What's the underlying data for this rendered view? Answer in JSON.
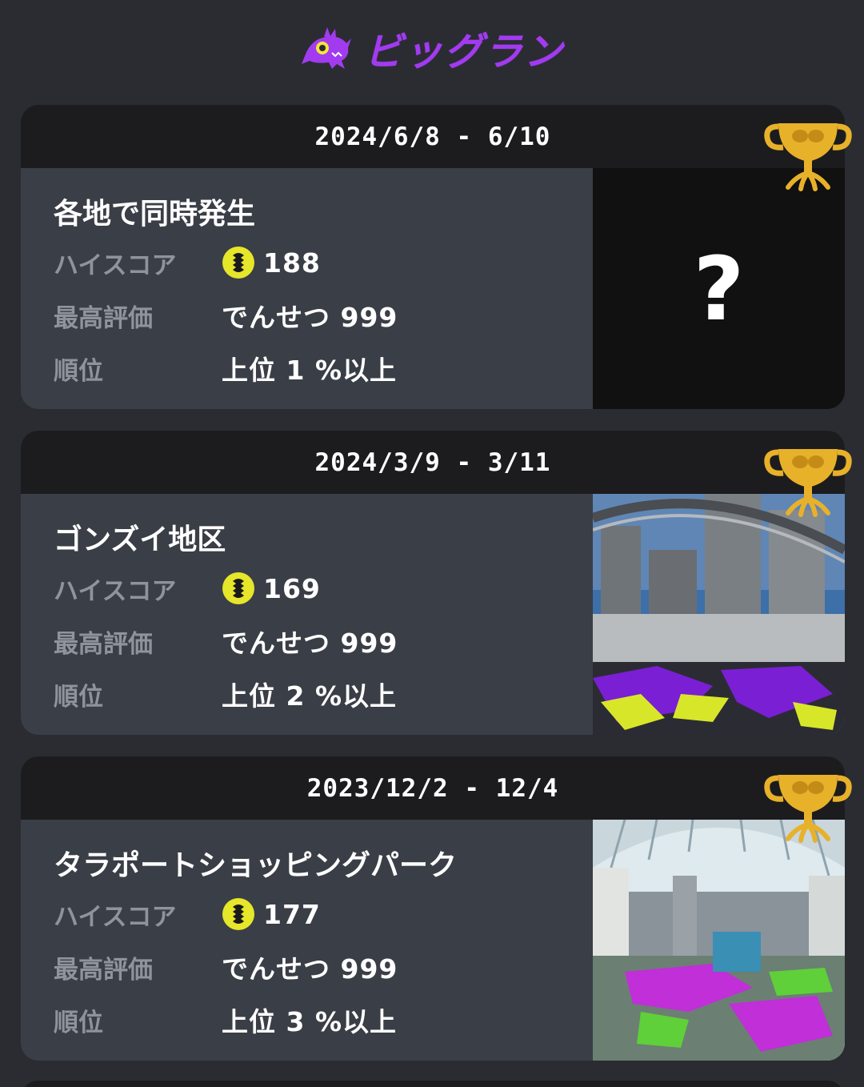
{
  "header": {
    "title": "ビッグラン",
    "brand_color": "#a23bf0"
  },
  "labels": {
    "high_score": "ハイスコア",
    "best_rating": "最高評価",
    "rank": "順位"
  },
  "mystery_mark": "?",
  "cards": [
    {
      "date_range": "2024/6/8 - 6/10",
      "stage": "各地で同時発生",
      "high_score": "188",
      "best_rating": "でんせつ 999",
      "rank": "上位 1 %以上"
    },
    {
      "date_range": "2024/3/9 - 3/11",
      "stage": "ゴンズイ地区",
      "high_score": "169",
      "best_rating": "でんせつ 999",
      "rank": "上位 2 %以上"
    },
    {
      "date_range": "2023/12/2 - 12/4",
      "stage": "タラポートショッピングパーク",
      "high_score": "177",
      "best_rating": "でんせつ 999",
      "rank": "上位 3 %以上"
    }
  ],
  "icons": {
    "coin": "golden-egg-icon",
    "trophy": "gold-trophy-icon",
    "mascot": "big-run-mascot-icon"
  },
  "colors": {
    "ink_purple": "#8a2be2",
    "ink_yellow": "#d8e62a",
    "trophy_gold": "#e8b12a"
  }
}
